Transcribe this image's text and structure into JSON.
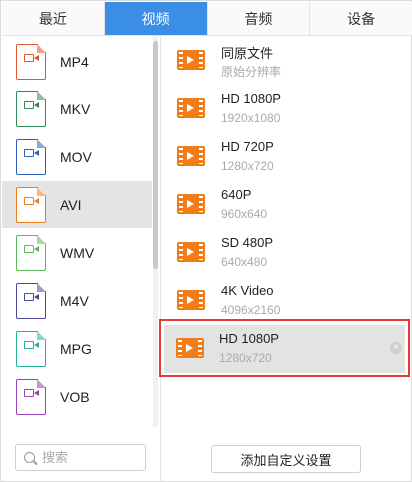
{
  "tabs": [
    "最近",
    "视频",
    "音频",
    "设备"
  ],
  "active_tab": "视频",
  "formats": [
    {
      "label": "MP4",
      "tag": "MP4",
      "color": "#e0562c"
    },
    {
      "label": "MKV",
      "tag": "MKV",
      "color": "#2e8b57"
    },
    {
      "label": "MOV",
      "tag": "MOV",
      "color": "#2f5fb8"
    },
    {
      "label": "AVI",
      "tag": "AVI",
      "color": "#ef7d1a"
    },
    {
      "label": "WMV",
      "tag": "WMV",
      "color": "#5cb85c"
    },
    {
      "label": "M4V",
      "tag": "M4V",
      "color": "#4a4a9a"
    },
    {
      "label": "MPG",
      "tag": "MPG",
      "color": "#24b39b"
    },
    {
      "label": "VOB",
      "tag": "VOB",
      "color": "#9a3fb5"
    }
  ],
  "selected_format": "AVI",
  "presets": [
    {
      "name": "同原文件",
      "res": "原始分辨率"
    },
    {
      "name": "HD 1080P",
      "res": "1920x1080"
    },
    {
      "name": "HD 720P",
      "res": "1280x720"
    },
    {
      "name": "640P",
      "res": "960x640"
    },
    {
      "name": "SD 480P",
      "res": "640x480"
    },
    {
      "name": "4K Video",
      "res": "4096x2160"
    }
  ],
  "custom_preset": {
    "name": "HD 1080P",
    "res": "1280x720",
    "close_glyph": "×"
  },
  "search": {
    "placeholder": "搜索"
  },
  "add_button": "添加自定义设置",
  "colors": {
    "accent": "#3a8ee6",
    "highlight_border": "#e53935",
    "video_icon": "#ef7d1a"
  }
}
